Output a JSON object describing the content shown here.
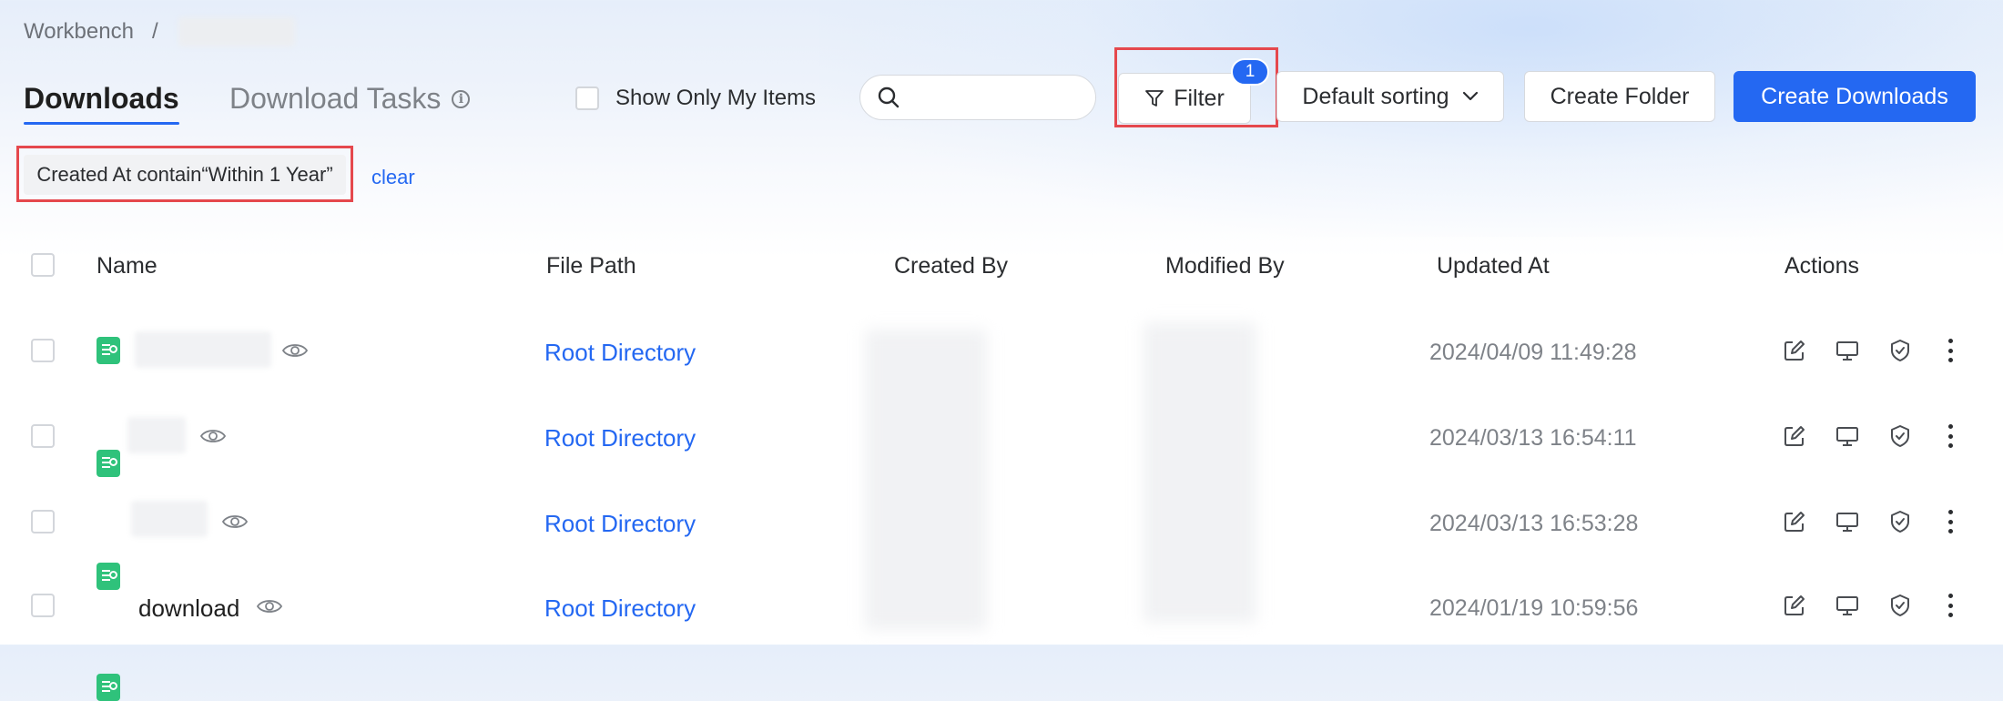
{
  "breadcrumb": {
    "root": "Workbench",
    "separator": "/"
  },
  "tabs": [
    {
      "label": "Downloads",
      "active": true
    },
    {
      "label": "Download Tasks",
      "active": false
    }
  ],
  "toolbar": {
    "show_only_mine": "Show Only My Items",
    "search_placeholder": "",
    "filter_label": "Filter",
    "filter_count": "1",
    "sort_label": "Default sorting",
    "create_folder": "Create Folder",
    "create_downloads": "Create Downloads"
  },
  "active_filter": {
    "tag": "Created At contain“Within 1 Year”",
    "clear": "clear"
  },
  "table": {
    "columns": [
      "Name",
      "File Path",
      "Created By",
      "Modified By",
      "Updated At",
      "Actions"
    ],
    "rows": [
      {
        "name": "",
        "path": "Root Directory",
        "updated": "2024/04/09 11:49:28"
      },
      {
        "name": "",
        "path": "Root Directory",
        "updated": "2024/03/13 16:54:11"
      },
      {
        "name": "",
        "path": "Root Directory",
        "updated": "2024/03/13 16:53:28"
      },
      {
        "name": "download",
        "path": "Root Directory",
        "updated": "2024/01/19 10:59:56"
      }
    ]
  },
  "colors": {
    "accent": "#2468f2",
    "highlight": "#e5484d",
    "file_icon": "#2fc27b"
  },
  "icons": [
    "info-icon",
    "search-icon",
    "filter-icon",
    "chevron-down-icon",
    "file-icon",
    "eye-icon",
    "edit-icon",
    "monitor-icon",
    "shield-check-icon",
    "more-vertical-icon"
  ]
}
